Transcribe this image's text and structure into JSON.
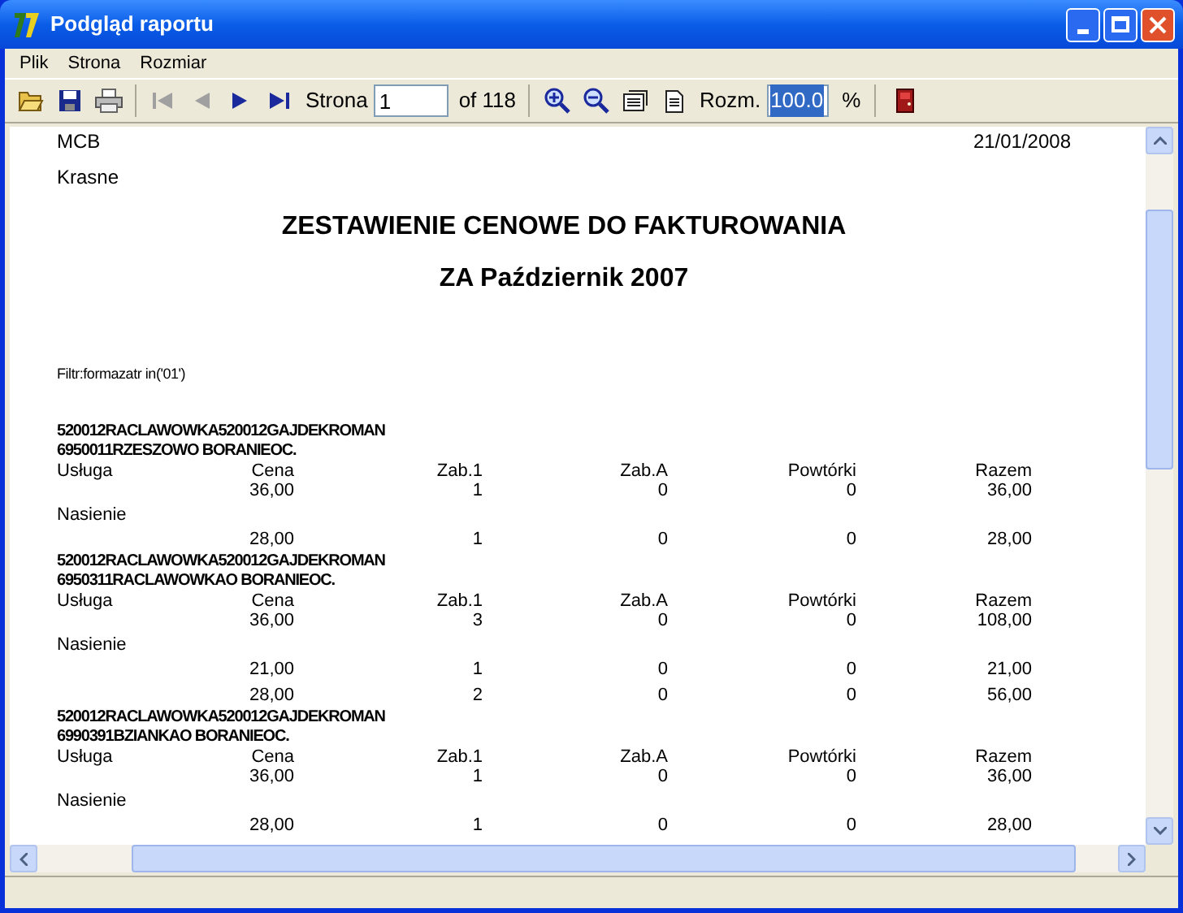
{
  "window": {
    "title": "Podgląd raportu"
  },
  "menu": [
    "Plik",
    "Strona",
    "Rozmiar"
  ],
  "toolbar": {
    "buttons": [
      {
        "kind": "open",
        "disabled": false
      },
      {
        "kind": "save",
        "disabled": false
      },
      {
        "kind": "print",
        "disabled": false
      },
      {
        "kind": "first",
        "disabled": true
      },
      {
        "kind": "prev",
        "disabled": true
      },
      {
        "kind": "next",
        "disabled": false
      },
      {
        "kind": "last",
        "disabled": false
      }
    ],
    "page_label": "Strona",
    "page_value": "1",
    "page_total": "of 118",
    "zoom_buttons": [
      {
        "kind": "zoom_in"
      },
      {
        "kind": "zoom_out"
      },
      {
        "kind": "page_width"
      },
      {
        "kind": "whole_page"
      }
    ],
    "zoom_label": "Rozm.",
    "zoom_value": "100.0",
    "zoom_selected": true,
    "zoom_unit": "%"
  },
  "report": {
    "company": "MCB",
    "date": "21/01/2008",
    "place": "Krasne",
    "title": "ZESTAWIENIE CENOWE DO FAKTUROWANIA",
    "subtitle": "ZA Październik 2007",
    "filter": "Filtr:formazatr in('01')",
    "groups": [
      {
        "header": [
          "520012RACLAWOWKA520012GAJDEKROMAN",
          "6950011RZESZOWO BORANIEOC."
        ],
        "columns": [
          "Usługa",
          "Cena",
          "Zab.1",
          "Zab.A",
          "Powtórki",
          "Razem"
        ],
        "rows": [
          {
            "kind": "values",
            "cells": [
              "36,00",
              "1",
              "0",
              "0",
              "36,00"
            ]
          },
          {
            "kind": "label",
            "text": "Nasienie"
          },
          {
            "kind": "values",
            "cells": [
              "28,00",
              "1",
              "0",
              "0",
              "28,00"
            ]
          }
        ]
      },
      {
        "header": [
          "520012RACLAWOWKA520012GAJDEKROMAN",
          "6950311RACLAWOWKAO BORANIEOC."
        ],
        "columns": [
          "Usługa",
          "Cena",
          "Zab.1",
          "Zab.A",
          "Powtórki",
          "Razem"
        ],
        "rows": [
          {
            "kind": "values",
            "cells": [
              "36,00",
              "3",
              "0",
              "0",
              "108,00"
            ]
          },
          {
            "kind": "label",
            "text": "Nasienie"
          },
          {
            "kind": "values",
            "cells": [
              "21,00",
              "1",
              "0",
              "0",
              "21,00"
            ]
          },
          {
            "kind": "values",
            "cells": [
              "28,00",
              "2",
              "0",
              "0",
              "56,00"
            ]
          }
        ]
      },
      {
        "header": [
          "520012RACLAWOWKA520012GAJDEKROMAN",
          "6990391BZIANKAO BORANIEOC."
        ],
        "columns": [
          "Usługa",
          "Cena",
          "Zab.1",
          "Zab.A",
          "Powtórki",
          "Razem"
        ],
        "rows": [
          {
            "kind": "values",
            "cells": [
              "36,00",
              "1",
              "0",
              "0",
              "36,00"
            ]
          },
          {
            "kind": "label",
            "text": "Nasienie"
          },
          {
            "kind": "values",
            "cells": [
              "28,00",
              "1",
              "0",
              "0",
              "28,00"
            ]
          }
        ]
      }
    ]
  }
}
